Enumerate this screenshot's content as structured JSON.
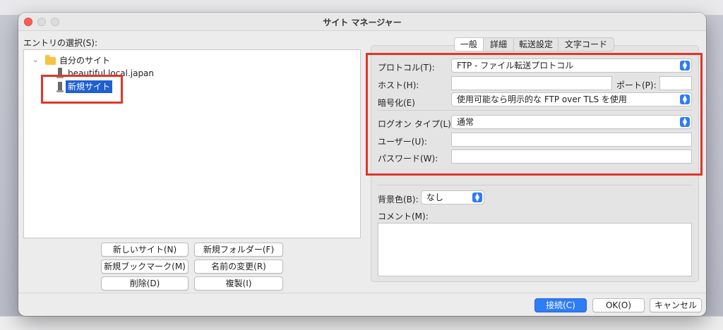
{
  "window": {
    "title": "サイト マネージャー"
  },
  "entry_label": "エントリの選択(S):",
  "tree": {
    "root": {
      "label": "自分のサイト",
      "icon": "folder-icon",
      "expanded": true
    },
    "items": [
      {
        "label": "beautiful.local.japan",
        "icon": "server-icon"
      },
      {
        "label": "新規サイト",
        "icon": "server-icon",
        "selected": true
      }
    ]
  },
  "left_buttons": {
    "new_site": "新しいサイト(N)",
    "new_folder": "新規フォルダー(F)",
    "new_bookmark": "新規ブックマーク(M)",
    "rename": "名前の変更(R)",
    "delete": "削除(D)",
    "duplicate": "複製(I)"
  },
  "tabs": [
    {
      "label": "一般",
      "active": true
    },
    {
      "label": "詳細"
    },
    {
      "label": "転送設定"
    },
    {
      "label": "文字コード"
    }
  ],
  "general": {
    "protocol_label": "プロトコル(T):",
    "protocol_value": "FTP - ファイル転送プロトコル",
    "host_label": "ホスト(H):",
    "host_value": "",
    "port_label": "ポート(P):",
    "port_value": "",
    "encryption_label": "暗号化(E)",
    "encryption_value": "使用可能なら明示的な FTP over TLS を使用",
    "logon_type_label": "ログオン タイプ(L):",
    "logon_type_value": "通常",
    "user_label": "ユーザー(U):",
    "user_value": "",
    "password_label": "パスワード(W):",
    "password_value": "",
    "background_color_label": "背景色(B):",
    "background_color_value": "なし",
    "comment_label": "コメント(M):",
    "comment_value": ""
  },
  "footer_buttons": {
    "connect": "接続(C)",
    "ok": "OK(O)",
    "cancel": "キャンセル"
  },
  "colors": {
    "accent": "#2e7cf6",
    "selection": "#1f5fd1",
    "highlight_box": "#e0362a"
  }
}
